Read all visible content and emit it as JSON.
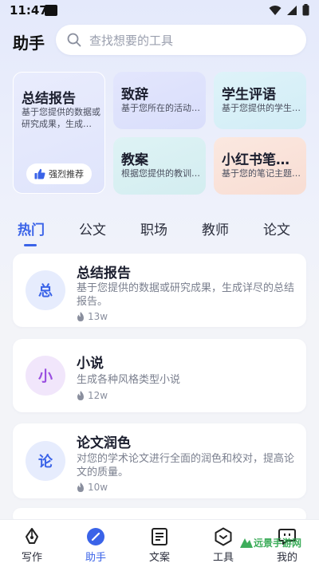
{
  "status": {
    "time": "11:47"
  },
  "header": {
    "title": "助手",
    "search_placeholder": "查找想要的工具"
  },
  "cards": {
    "big": {
      "title": "总结报告",
      "desc": "基于您提供的数据或研究成果，生成…",
      "button": "强烈推荐"
    },
    "zhici": {
      "title": "致辞",
      "desc": "基于您所在的活动…"
    },
    "pingyu": {
      "title": "学生评语",
      "desc": "基于您提供的学生…"
    },
    "jiaoan": {
      "title": "教案",
      "desc": "根据您提供的教训…"
    },
    "xhs": {
      "title": "小红书笔…",
      "desc": "基于您的笔记主题…"
    }
  },
  "tabs": [
    "热门",
    "公文",
    "职场",
    "教师",
    "论文"
  ],
  "list": [
    {
      "avatar": "总",
      "title": "总结报告",
      "desc": "基于您提供的数据或研究成果，生成详尽的总结报告。",
      "count": "13w"
    },
    {
      "avatar": "小",
      "title": "小说",
      "desc": "生成各种风格类型小说",
      "count": "12w"
    },
    {
      "avatar": "论",
      "title": "论文润色",
      "desc": "对您的学术论文进行全面的润色和校对，提高论文的质量。",
      "count": "10w"
    }
  ],
  "nav": [
    "写作",
    "助手",
    "文案",
    "工具",
    "我的"
  ],
  "watermark": "远景手游网",
  "colors": {
    "accent": "#3a63e8",
    "avatar_blue": "#e6ecfd",
    "avatar_purple": "#f1e6fb"
  }
}
